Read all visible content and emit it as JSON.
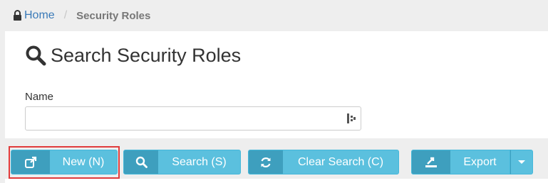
{
  "breadcrumb": {
    "home_label": "Home",
    "separator": "/",
    "current_label": "Security Roles"
  },
  "search_panel": {
    "title": "Search Security Roles",
    "name_field": {
      "label": "Name",
      "value": "",
      "placeholder": ""
    }
  },
  "actions": {
    "new_label": "New (N)",
    "search_label": "Search (S)",
    "clear_label": "Clear Search (C)",
    "export_label": "Export"
  },
  "icons": {
    "breadcrumb": "lock-icon",
    "title": "search-icon",
    "field": "field-options-icon",
    "new": "external-link-icon",
    "search": "search-icon",
    "clear": "refresh-icon",
    "export": "export-icon",
    "dropdown": "caret-down-icon"
  },
  "colors": {
    "link": "#3a7ab8",
    "button": "#5bc0de",
    "button_icon_bg": "#3e9fbe",
    "highlight_outline": "#e03b3b"
  }
}
